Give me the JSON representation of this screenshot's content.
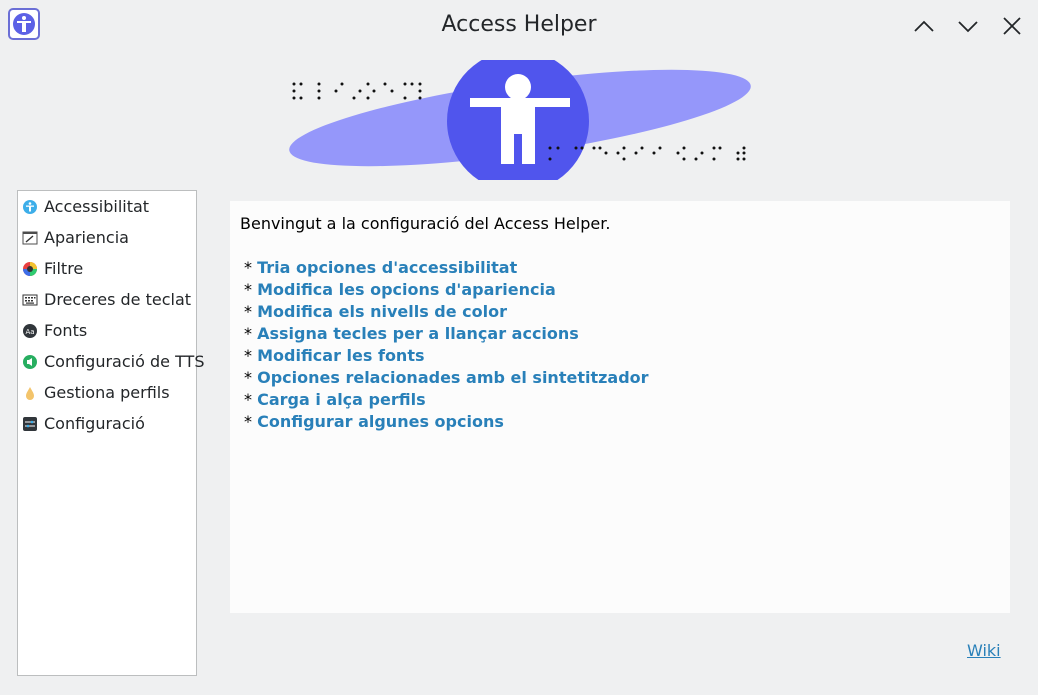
{
  "window": {
    "title": "Access Helper",
    "app_icon": "accessibility-icon"
  },
  "controls": [
    "minimize-icon",
    "maximize-icon",
    "close-icon"
  ],
  "sidebar": {
    "items": [
      {
        "label": "Accessibilitat",
        "icon": "accessibility-icon"
      },
      {
        "label": "Apariencia",
        "icon": "appearance-icon"
      },
      {
        "label": "Filtre",
        "icon": "color-filter-icon"
      },
      {
        "label": "Dreceres de teclat",
        "icon": "keyboard-icon"
      },
      {
        "label": "Fonts",
        "icon": "fonts-icon"
      },
      {
        "label": "Configuració de TTS",
        "icon": "tts-icon"
      },
      {
        "label": "Gestiona perfils",
        "icon": "profiles-icon"
      },
      {
        "label": "Configuració",
        "icon": "settings-icon"
      }
    ]
  },
  "main": {
    "welcome": "Benvingut a la configuració del Access Helper.",
    "bullet": "*",
    "links": [
      "Tria opciones d'accessibilitat",
      "Modifica les opcions d'apariencia",
      "Modifica els nivells de color",
      "Assigna tecles per a llançar accions",
      "Modificar les fonts",
      "Opciones relacionades amb el sintetitzador",
      "Carga i alça perfils",
      "Configurar algunes opcions"
    ]
  },
  "footer": {
    "wiki_link": "Wiki"
  },
  "colors": {
    "accent": "#2980b9",
    "banner_ellipse": "#9597fa",
    "banner_circle": "#5055ed"
  }
}
